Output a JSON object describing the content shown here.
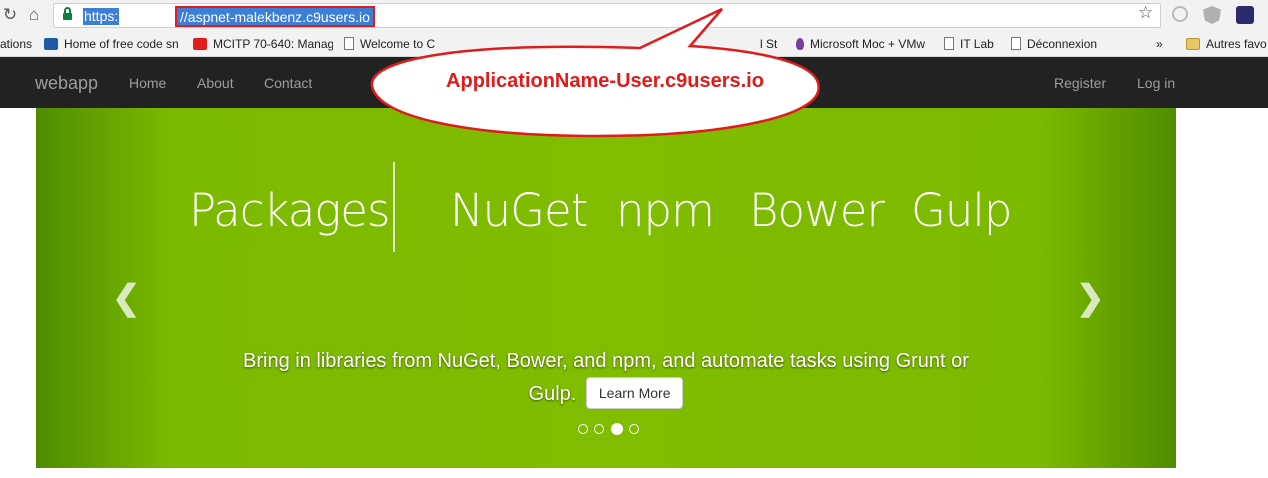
{
  "browser": {
    "url_scheme": "https:",
    "url_host": "//aspnet-malekbenz.c9users.io",
    "bookmarks": [
      "ations",
      "Home of free code sn",
      "MCITP 70-640: Manag",
      "Welcome to C",
      "l St",
      "Microsoft Moc + VMw",
      "IT Lab",
      "Déconnexion",
      "»",
      "Autres favo"
    ]
  },
  "navbar": {
    "brand": "webapp",
    "links": [
      "Home",
      "About",
      "Contact"
    ],
    "right_links": [
      "Register",
      "Log in"
    ]
  },
  "carousel": {
    "heading": "Packages",
    "items": [
      "NuGet",
      "npm",
      "Bower",
      "Gulp"
    ],
    "caption": "Bring in libraries from NuGet, Bower, and npm, and automate tasks using Grunt or Gulp.",
    "button_label": "Learn More",
    "slide_count": 4,
    "active_slide": 3,
    "prev_icon": "chevron-left-icon",
    "next_icon": "chevron-right-icon"
  },
  "callout": {
    "text": "ApplicationName-User.c9users.io",
    "color": "#e01b1b"
  },
  "colors": {
    "navbar": "#222222",
    "carousel_green": "#80bc00",
    "selection_blue": "#3d7fd6"
  }
}
